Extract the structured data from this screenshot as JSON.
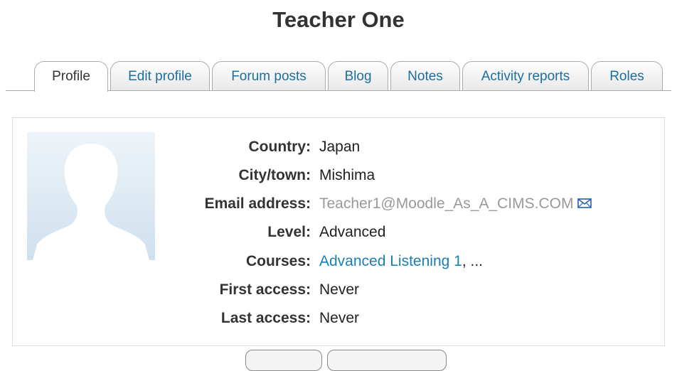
{
  "profile": {
    "name": "Teacher One"
  },
  "tabs": [
    {
      "label": "Profile",
      "active": true
    },
    {
      "label": "Edit profile",
      "active": false
    },
    {
      "label": "Forum posts",
      "active": false
    },
    {
      "label": "Blog",
      "active": false
    },
    {
      "label": "Notes",
      "active": false
    },
    {
      "label": "Activity reports",
      "active": false
    },
    {
      "label": "Roles",
      "active": false
    }
  ],
  "fields": {
    "country": {
      "label": "Country:",
      "value": "Japan"
    },
    "city": {
      "label": "City/town:",
      "value": "Mishima"
    },
    "email": {
      "label": "Email address:",
      "value": "Teacher1@Moodle_As_A_CIMS.COM",
      "icon": "envelope-icon"
    },
    "level": {
      "label": "Level:",
      "value": "Advanced"
    },
    "courses": {
      "label": "Courses:",
      "link": "Advanced Listening 1",
      "suffix": ", ..."
    },
    "first_access": {
      "label": "First access:",
      "value": "Never"
    },
    "last_access": {
      "label": "Last access:",
      "value": "Never"
    }
  },
  "colors": {
    "link": "#1b7fb0",
    "tab_text": "#1b6fa0",
    "avatar_bg": "#cfe0ee"
  }
}
